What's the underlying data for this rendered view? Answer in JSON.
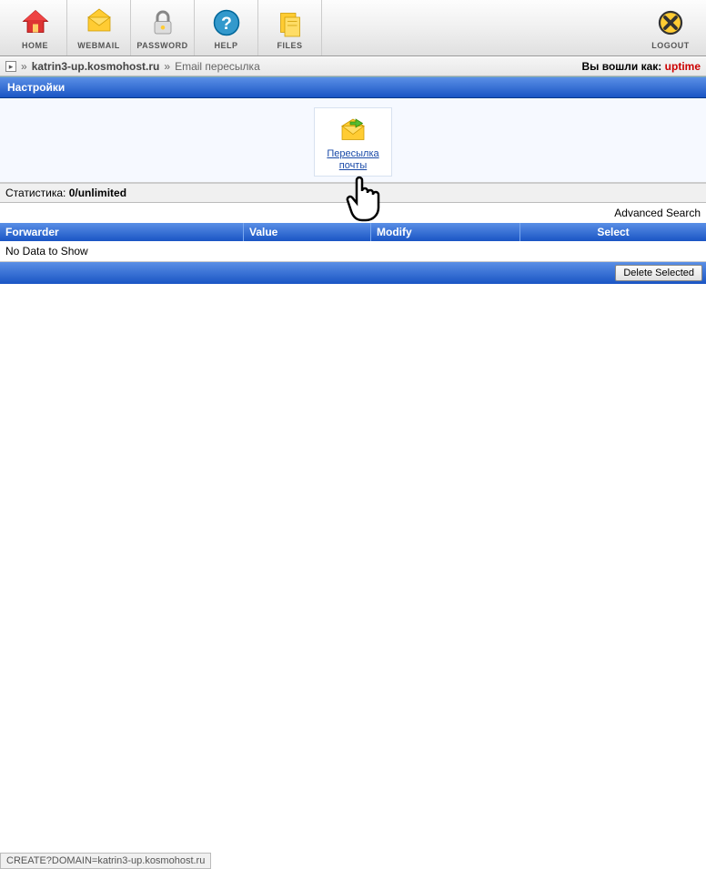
{
  "toolbar": {
    "home": "HOME",
    "webmail": "WEBMAIL",
    "password": "PASSWORD",
    "help": "HELP",
    "files": "FILES",
    "logout": "LOGOUT"
  },
  "breadcrumb": {
    "sep": "»",
    "domain": "katrin3-up.kosmohost.ru",
    "page": "Email пересылка",
    "login_label": "Вы вошли как:",
    "login_user": "uptime"
  },
  "settings": {
    "header": "Настройки",
    "forward_link": "Пересылка почты"
  },
  "stats": {
    "label": "Статистика:",
    "value": "0/unlimited"
  },
  "advanced_search": "Advanced Search",
  "table": {
    "columns": {
      "forwarder": "Forwarder",
      "value": "Value",
      "modify": "Modify",
      "select": "Select"
    },
    "no_data": "No Data to Show"
  },
  "delete_button": "Delete Selected",
  "status_bar": "CREATE?DOMAIN=katrin3-up.kosmohost.ru"
}
